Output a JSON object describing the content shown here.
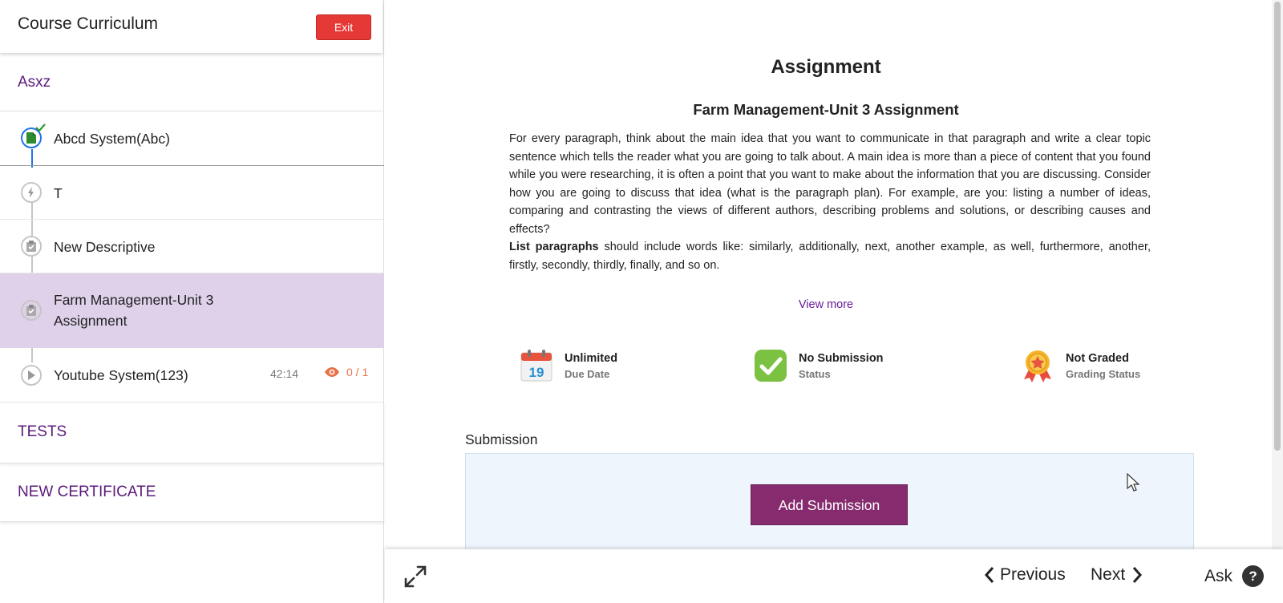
{
  "sidebar": {
    "title": "Course Curriculum",
    "exit_label": "Exit",
    "section_title": "Asxz",
    "items": [
      {
        "label": "Abcd System(Abc)",
        "icon": "document-complete-icon"
      },
      {
        "label": "T",
        "icon": "lightning-icon"
      },
      {
        "label": "New Descriptive",
        "icon": "clipboard-icon"
      },
      {
        "label": "Farm Management-Unit 3 Assignment",
        "icon": "clipboard-icon",
        "active": true
      },
      {
        "label": "Youtube System(123)",
        "icon": "play-icon",
        "duration": "42:14",
        "views": "0 / 1"
      }
    ],
    "tests_label": "TESTS",
    "certificate_label": "NEW CERTIFICATE"
  },
  "main": {
    "heading": "Assignment",
    "assignment_title": "Farm Management-Unit 3 Assignment",
    "description": "For every paragraph, think about the main idea that you want to communicate in that paragraph and write a clear topic sentence which tells the reader what you are going to talk about. A main idea is more than a piece of content that you found while you were researching, it is often a point that you want to make about the information that you are discussing. Consider how you are going to discuss that idea (what is the paragraph plan). For example, are you: listing a number of ideas, comparing and contrasting the views of different authors, describing problems and solutions, or describing causes and effects?",
    "list_bold": "List paragraphs",
    "list_rest": " should include words like: similarly, additionally, next, another example, as well, furthermore, another, firstly, secondly, thirdly, finally, and so on.",
    "view_more": "View more",
    "meta": [
      {
        "value": "Unlimited",
        "label": "Due Date",
        "icon": "calendar-icon",
        "day": "19"
      },
      {
        "value": "No Submission",
        "label": "Status",
        "icon": "check-icon"
      },
      {
        "value": "Not Graded",
        "label": "Grading Status",
        "icon": "award-icon"
      }
    ],
    "submission_label": "Submission",
    "add_submission": "Add Submission"
  },
  "bottom": {
    "previous": "Previous",
    "next": "Next",
    "ask": "Ask",
    "ask_icon": "?"
  }
}
